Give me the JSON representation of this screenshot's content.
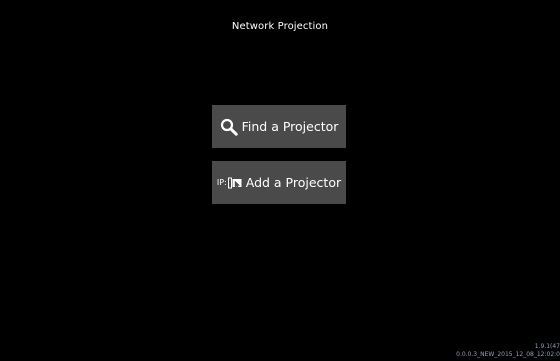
{
  "header": {
    "title": "Network Projection"
  },
  "buttons": {
    "find": {
      "label": "Find a Projector",
      "icon": "search-icon"
    },
    "add": {
      "prefix": "IP:",
      "label": "Add a Projector",
      "icon": "add-projector-icon"
    }
  },
  "footer": {
    "version_line1": "1.9.1(47",
    "version_line2": "0.0.0.3_NEW_2015_12_08_12:02:0"
  },
  "colors": {
    "background": "#000000",
    "button": "#4a4a4a",
    "text": "#ffffff",
    "version_text": "#8ca0b8"
  }
}
